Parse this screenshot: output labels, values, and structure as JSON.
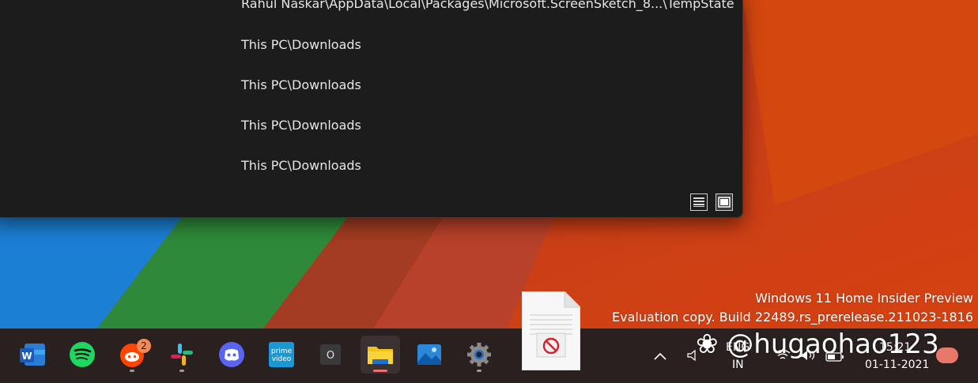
{
  "explorer": {
    "recent_paths": [
      "Rahul Naskar\\AppData\\Local\\Packages\\Microsoft.ScreenSketch_8...\\TempState",
      "This PC\\Downloads",
      "This PC\\Downloads",
      "This PC\\Downloads",
      "This PC\\Downloads"
    ]
  },
  "watermark": {
    "line1": "Windows 11 Home Insider Preview",
    "line2": "Evaluation copy. Build 22489.rs_prerelease.211023-1816"
  },
  "taskbar": {
    "apps": [
      {
        "name": "Microsoft Word",
        "icon": "word-icon"
      },
      {
        "name": "Spotify",
        "icon": "spotify-icon"
      },
      {
        "name": "Reddit",
        "icon": "reddit-icon",
        "badge": "2"
      },
      {
        "name": "Slack",
        "icon": "slack-icon"
      },
      {
        "name": "Discord",
        "icon": "discord-icon"
      },
      {
        "name": "Prime Video",
        "icon": "prime-video-icon",
        "label_line1": "prime",
        "label_line2": "video"
      },
      {
        "name": "Unknown app",
        "icon": "o-icon",
        "label": "O"
      },
      {
        "name": "File Explorer",
        "icon": "folder-icon"
      },
      {
        "name": "Photos",
        "icon": "photos-icon"
      },
      {
        "name": "Settings",
        "icon": "gear-icon"
      }
    ],
    "tray": {
      "language": "ENG",
      "region": "IN",
      "time": "15:21",
      "date": "01-11-2021"
    }
  },
  "watermark_overlay": "@hugaohao123",
  "colors": {
    "taskbar_bg": "#2a2020",
    "explorer_bg": "#1c1c1c",
    "active_indicator": "#ef6f6f"
  }
}
